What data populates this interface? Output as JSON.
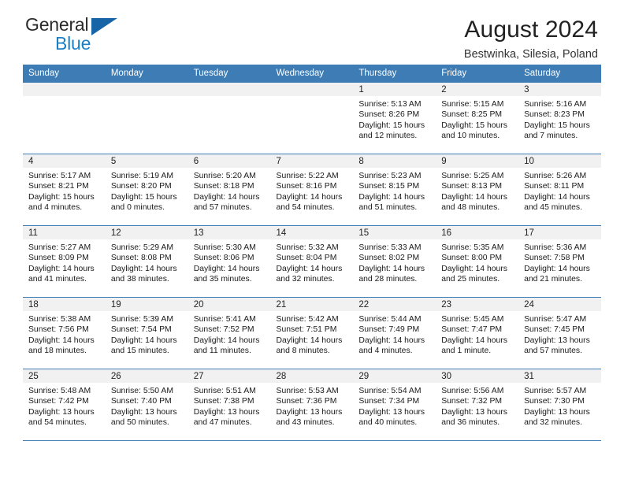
{
  "brand": {
    "line1": "General",
    "line2": "Blue",
    "logo_icon": "triangle-flag-icon",
    "color_dark": "#2b2b2b",
    "color_blue": "#1b7fc4"
  },
  "header": {
    "title": "August 2024",
    "subtitle": "Bestwinka, Silesia, Poland"
  },
  "theme": {
    "header_bg": "#3d7cb5",
    "daynum_bg": "#f1f1f1",
    "grid_line": "#3d7cb5"
  },
  "weekday_headers": [
    "Sunday",
    "Monday",
    "Tuesday",
    "Wednesday",
    "Thursday",
    "Friday",
    "Saturday"
  ],
  "weeks": [
    [
      {
        "day": "",
        "sunrise": "",
        "sunset": "",
        "daylight_1": "",
        "daylight_2": ""
      },
      {
        "day": "",
        "sunrise": "",
        "sunset": "",
        "daylight_1": "",
        "daylight_2": ""
      },
      {
        "day": "",
        "sunrise": "",
        "sunset": "",
        "daylight_1": "",
        "daylight_2": ""
      },
      {
        "day": "",
        "sunrise": "",
        "sunset": "",
        "daylight_1": "",
        "daylight_2": ""
      },
      {
        "day": "1",
        "sunrise": "Sunrise: 5:13 AM",
        "sunset": "Sunset: 8:26 PM",
        "daylight_1": "Daylight: 15 hours",
        "daylight_2": "and 12 minutes."
      },
      {
        "day": "2",
        "sunrise": "Sunrise: 5:15 AM",
        "sunset": "Sunset: 8:25 PM",
        "daylight_1": "Daylight: 15 hours",
        "daylight_2": "and 10 minutes."
      },
      {
        "day": "3",
        "sunrise": "Sunrise: 5:16 AM",
        "sunset": "Sunset: 8:23 PM",
        "daylight_1": "Daylight: 15 hours",
        "daylight_2": "and 7 minutes."
      }
    ],
    [
      {
        "day": "4",
        "sunrise": "Sunrise: 5:17 AM",
        "sunset": "Sunset: 8:21 PM",
        "daylight_1": "Daylight: 15 hours",
        "daylight_2": "and 4 minutes."
      },
      {
        "day": "5",
        "sunrise": "Sunrise: 5:19 AM",
        "sunset": "Sunset: 8:20 PM",
        "daylight_1": "Daylight: 15 hours",
        "daylight_2": "and 0 minutes."
      },
      {
        "day": "6",
        "sunrise": "Sunrise: 5:20 AM",
        "sunset": "Sunset: 8:18 PM",
        "daylight_1": "Daylight: 14 hours",
        "daylight_2": "and 57 minutes."
      },
      {
        "day": "7",
        "sunrise": "Sunrise: 5:22 AM",
        "sunset": "Sunset: 8:16 PM",
        "daylight_1": "Daylight: 14 hours",
        "daylight_2": "and 54 minutes."
      },
      {
        "day": "8",
        "sunrise": "Sunrise: 5:23 AM",
        "sunset": "Sunset: 8:15 PM",
        "daylight_1": "Daylight: 14 hours",
        "daylight_2": "and 51 minutes."
      },
      {
        "day": "9",
        "sunrise": "Sunrise: 5:25 AM",
        "sunset": "Sunset: 8:13 PM",
        "daylight_1": "Daylight: 14 hours",
        "daylight_2": "and 48 minutes."
      },
      {
        "day": "10",
        "sunrise": "Sunrise: 5:26 AM",
        "sunset": "Sunset: 8:11 PM",
        "daylight_1": "Daylight: 14 hours",
        "daylight_2": "and 45 minutes."
      }
    ],
    [
      {
        "day": "11",
        "sunrise": "Sunrise: 5:27 AM",
        "sunset": "Sunset: 8:09 PM",
        "daylight_1": "Daylight: 14 hours",
        "daylight_2": "and 41 minutes."
      },
      {
        "day": "12",
        "sunrise": "Sunrise: 5:29 AM",
        "sunset": "Sunset: 8:08 PM",
        "daylight_1": "Daylight: 14 hours",
        "daylight_2": "and 38 minutes."
      },
      {
        "day": "13",
        "sunrise": "Sunrise: 5:30 AM",
        "sunset": "Sunset: 8:06 PM",
        "daylight_1": "Daylight: 14 hours",
        "daylight_2": "and 35 minutes."
      },
      {
        "day": "14",
        "sunrise": "Sunrise: 5:32 AM",
        "sunset": "Sunset: 8:04 PM",
        "daylight_1": "Daylight: 14 hours",
        "daylight_2": "and 32 minutes."
      },
      {
        "day": "15",
        "sunrise": "Sunrise: 5:33 AM",
        "sunset": "Sunset: 8:02 PM",
        "daylight_1": "Daylight: 14 hours",
        "daylight_2": "and 28 minutes."
      },
      {
        "day": "16",
        "sunrise": "Sunrise: 5:35 AM",
        "sunset": "Sunset: 8:00 PM",
        "daylight_1": "Daylight: 14 hours",
        "daylight_2": "and 25 minutes."
      },
      {
        "day": "17",
        "sunrise": "Sunrise: 5:36 AM",
        "sunset": "Sunset: 7:58 PM",
        "daylight_1": "Daylight: 14 hours",
        "daylight_2": "and 21 minutes."
      }
    ],
    [
      {
        "day": "18",
        "sunrise": "Sunrise: 5:38 AM",
        "sunset": "Sunset: 7:56 PM",
        "daylight_1": "Daylight: 14 hours",
        "daylight_2": "and 18 minutes."
      },
      {
        "day": "19",
        "sunrise": "Sunrise: 5:39 AM",
        "sunset": "Sunset: 7:54 PM",
        "daylight_1": "Daylight: 14 hours",
        "daylight_2": "and 15 minutes."
      },
      {
        "day": "20",
        "sunrise": "Sunrise: 5:41 AM",
        "sunset": "Sunset: 7:52 PM",
        "daylight_1": "Daylight: 14 hours",
        "daylight_2": "and 11 minutes."
      },
      {
        "day": "21",
        "sunrise": "Sunrise: 5:42 AM",
        "sunset": "Sunset: 7:51 PM",
        "daylight_1": "Daylight: 14 hours",
        "daylight_2": "and 8 minutes."
      },
      {
        "day": "22",
        "sunrise": "Sunrise: 5:44 AM",
        "sunset": "Sunset: 7:49 PM",
        "daylight_1": "Daylight: 14 hours",
        "daylight_2": "and 4 minutes."
      },
      {
        "day": "23",
        "sunrise": "Sunrise: 5:45 AM",
        "sunset": "Sunset: 7:47 PM",
        "daylight_1": "Daylight: 14 hours",
        "daylight_2": "and 1 minute."
      },
      {
        "day": "24",
        "sunrise": "Sunrise: 5:47 AM",
        "sunset": "Sunset: 7:45 PM",
        "daylight_1": "Daylight: 13 hours",
        "daylight_2": "and 57 minutes."
      }
    ],
    [
      {
        "day": "25",
        "sunrise": "Sunrise: 5:48 AM",
        "sunset": "Sunset: 7:42 PM",
        "daylight_1": "Daylight: 13 hours",
        "daylight_2": "and 54 minutes."
      },
      {
        "day": "26",
        "sunrise": "Sunrise: 5:50 AM",
        "sunset": "Sunset: 7:40 PM",
        "daylight_1": "Daylight: 13 hours",
        "daylight_2": "and 50 minutes."
      },
      {
        "day": "27",
        "sunrise": "Sunrise: 5:51 AM",
        "sunset": "Sunset: 7:38 PM",
        "daylight_1": "Daylight: 13 hours",
        "daylight_2": "and 47 minutes."
      },
      {
        "day": "28",
        "sunrise": "Sunrise: 5:53 AM",
        "sunset": "Sunset: 7:36 PM",
        "daylight_1": "Daylight: 13 hours",
        "daylight_2": "and 43 minutes."
      },
      {
        "day": "29",
        "sunrise": "Sunrise: 5:54 AM",
        "sunset": "Sunset: 7:34 PM",
        "daylight_1": "Daylight: 13 hours",
        "daylight_2": "and 40 minutes."
      },
      {
        "day": "30",
        "sunrise": "Sunrise: 5:56 AM",
        "sunset": "Sunset: 7:32 PM",
        "daylight_1": "Daylight: 13 hours",
        "daylight_2": "and 36 minutes."
      },
      {
        "day": "31",
        "sunrise": "Sunrise: 5:57 AM",
        "sunset": "Sunset: 7:30 PM",
        "daylight_1": "Daylight: 13 hours",
        "daylight_2": "and 32 minutes."
      }
    ]
  ]
}
